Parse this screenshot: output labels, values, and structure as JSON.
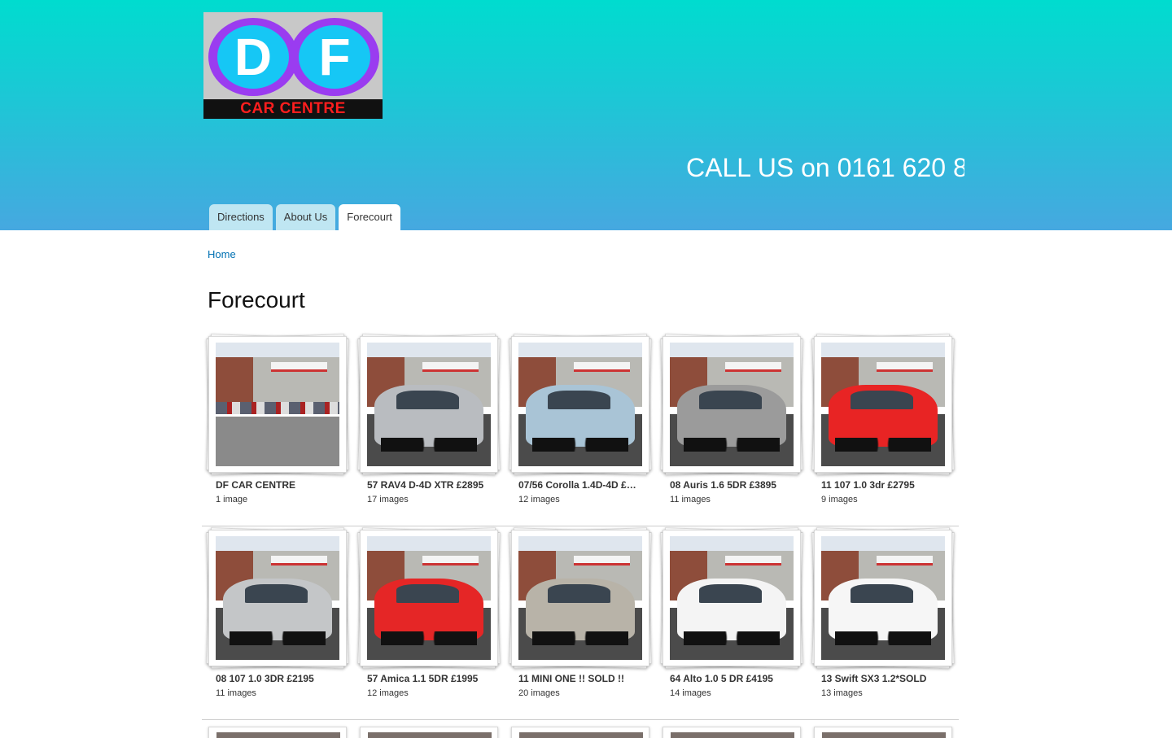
{
  "header": {
    "logo": {
      "letter1": "D",
      "letter2": "F",
      "tagline": "CAR CENTRE"
    },
    "phone_text": "CALL US on 0161 620 8",
    "tabs": [
      {
        "label": "Directions",
        "active": false
      },
      {
        "label": "About Us",
        "active": false
      },
      {
        "label": "Forecourt",
        "active": true
      }
    ]
  },
  "breadcrumb": {
    "home": "Home"
  },
  "page": {
    "title": "Forecourt"
  },
  "albums": [
    {
      "title": "DF CAR CENTRE",
      "count": "1 image",
      "car_color": ""
    },
    {
      "title": "57 RAV4 D-4D XTR £2895",
      "count": "17 images",
      "car_color": "#b9bcc0"
    },
    {
      "title": "07/56 Corolla 1.4D-4D £…",
      "count": "12 images",
      "car_color": "#a9c4d6"
    },
    {
      "title": "08 Auris 1.6 5DR £3895",
      "count": "11 images",
      "car_color": "#9b9b9b"
    },
    {
      "title": "11 107 1.0 3dr £2795",
      "count": "9 images",
      "car_color": "#e82424"
    },
    {
      "title": "08 107 1.0 3DR £2195",
      "count": "11 images",
      "car_color": "#c4c6c8"
    },
    {
      "title": "57 Amica 1.1 5DR £1995",
      "count": "12 images",
      "car_color": "#e52626"
    },
    {
      "title": "11 MINI ONE !! SOLD !!",
      "count": "20 images",
      "car_color": "#b8b3a8"
    },
    {
      "title": "64 Alto 1.0 5 DR £4195",
      "count": "14 images",
      "car_color": "#f4f4f4"
    },
    {
      "title": "13 Swift SX3 1.2*SOLD",
      "count": "13 images",
      "car_color": "#f6f6f6"
    }
  ]
}
